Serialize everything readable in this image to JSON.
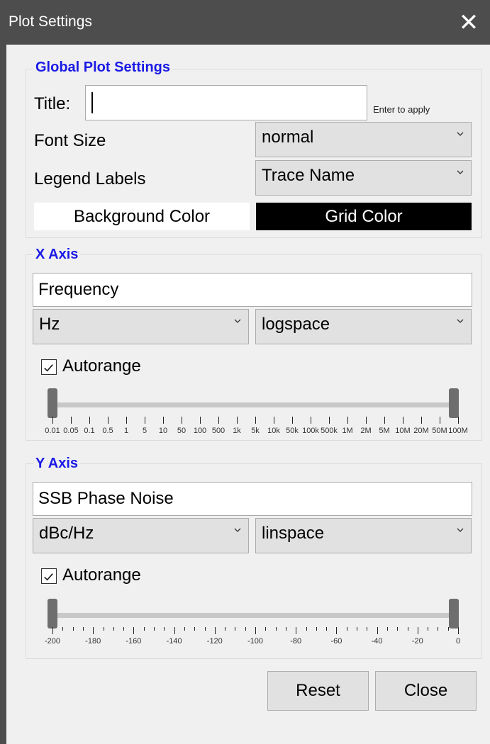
{
  "window": {
    "title": "Plot Settings",
    "close_glyph": "✕"
  },
  "global": {
    "legend": "Global Plot Settings",
    "title_label": "Title:",
    "title_value": "",
    "enter_hint": "Enter to apply",
    "font_size_label": "Font Size",
    "font_size_value": "normal",
    "legend_labels_label": "Legend Labels",
    "legend_labels_value": "Trace Name",
    "background_color_label": "Background Color",
    "grid_color_label": "Grid Color",
    "background_color": "#ffffff",
    "grid_color": "#000000"
  },
  "x_axis": {
    "legend": "X Axis",
    "label_value": "Frequency",
    "unit_value": "Hz",
    "spacing_value": "logspace",
    "autorange_checked": true,
    "autorange_label": "Autorange",
    "range_fraction": [
      0,
      1
    ],
    "tick_labels": [
      "0.01",
      "0.05",
      "0.1",
      "0.5",
      "1",
      "5",
      "10",
      "50",
      "100",
      "500",
      "1k",
      "5k",
      "10k",
      "50k",
      "100k",
      "500k",
      "1M",
      "2M",
      "5M",
      "10M",
      "20M",
      "50M",
      "100M"
    ]
  },
  "y_axis": {
    "legend": "Y Axis",
    "label_value": "SSB Phase Noise",
    "unit_value": "dBc/Hz",
    "spacing_value": "linspace",
    "autorange_checked": true,
    "autorange_label": "Autorange",
    "range_fraction": [
      0,
      1
    ],
    "tick_labels": [
      "-200",
      "-180",
      "-160",
      "-140",
      "-120",
      "-100",
      "-80",
      "-60",
      "-40",
      "-20",
      "0"
    ]
  },
  "buttons": {
    "reset": "Reset",
    "close": "Close"
  },
  "colors": {
    "accent": "#1a1ae6",
    "titlebar": "#4d4d4d",
    "panel": "#f0f0f0"
  }
}
